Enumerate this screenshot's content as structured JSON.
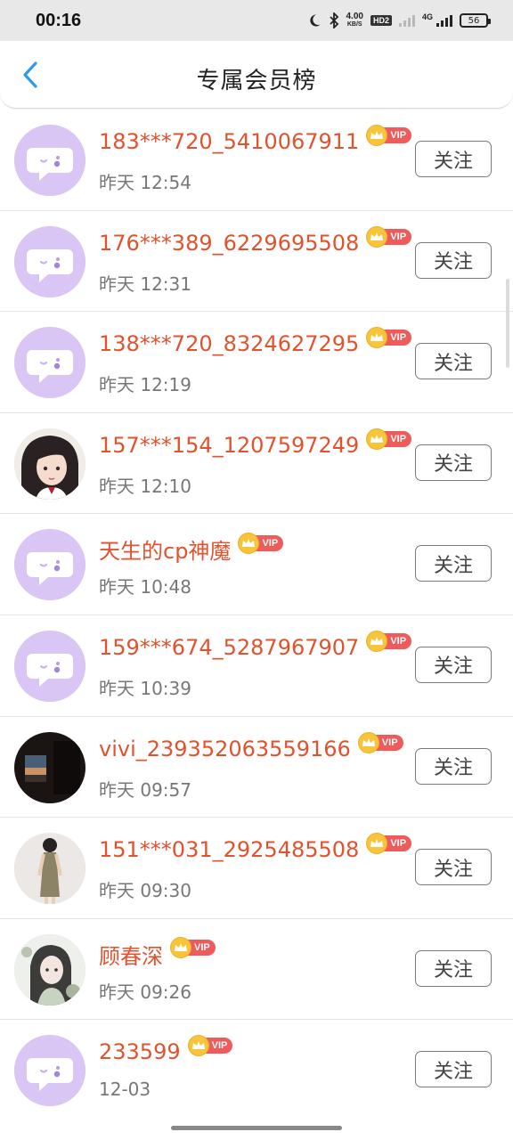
{
  "status_bar": {
    "time": "00:16",
    "net_speed_value": "4.00",
    "net_speed_unit": "KB/S",
    "hd_label": "HD2",
    "network_label": "4G",
    "battery": "56"
  },
  "header": {
    "title": "专属会员榜",
    "back_icon": "chevron-left-icon"
  },
  "colors": {
    "name": "#e2522d",
    "vip_badge": "#ef5a5a",
    "crown": "#f7c43a",
    "default_avatar_bg": "#d9c6f4",
    "back_arrow": "#2f9be8"
  },
  "follow_label": "关注",
  "vip_label": "VIP",
  "members": [
    {
      "name": "183***720_5410067911",
      "time": "昨天 12:54",
      "avatar": "default-chat-avatar"
    },
    {
      "name": "176***389_6229695508",
      "time": "昨天 12:31",
      "avatar": "default-chat-avatar"
    },
    {
      "name": "138***720_8324627295",
      "time": "昨天 12:19",
      "avatar": "default-chat-avatar"
    },
    {
      "name": "157***154_1207597249",
      "time": "昨天 12:10",
      "avatar": "anime-girl-photo"
    },
    {
      "name": "天生的cp神魔",
      "time": "昨天 10:48",
      "avatar": "default-chat-avatar"
    },
    {
      "name": "159***674_5287967907",
      "time": "昨天 10:39",
      "avatar": "default-chat-avatar"
    },
    {
      "name": "vivi_239352063559166",
      "time": "昨天 09:57",
      "avatar": "window-sky-photo"
    },
    {
      "name": "151***031_2925485508",
      "time": "昨天 09:30",
      "avatar": "woman-dress-photo"
    },
    {
      "name": "顾春深",
      "time": "昨天 09:26",
      "avatar": "illustration-girl-photo"
    },
    {
      "name": "233599",
      "time": "12-03",
      "avatar": "default-chat-avatar"
    }
  ]
}
